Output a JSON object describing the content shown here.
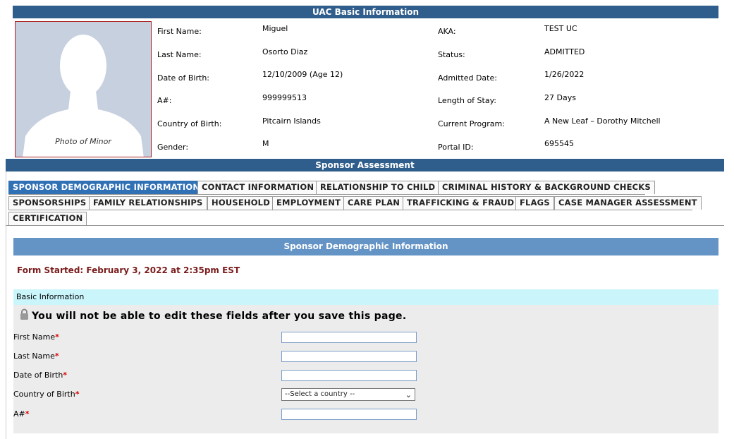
{
  "uac": {
    "header": "UAC Basic Information",
    "photo_caption": "Photo of Minor",
    "first_name_label": "First Name:",
    "first_name": "Miguel",
    "last_name_label": "Last Name:",
    "last_name": "Osorto Diaz",
    "dob_label": "Date of Birth:",
    "dob": "12/10/2009 (Age 12)",
    "anum_label": "A#:",
    "anum": "999999513",
    "country_label": "Country of Birth:",
    "country": "Pitcairn Islands",
    "gender_label": "Gender:",
    "gender": "M",
    "aka_label": "AKA:",
    "aka": "TEST UC",
    "status_label": "Status:",
    "status": "ADMITTED",
    "admitted_label": "Admitted Date:",
    "admitted": "1/26/2022",
    "los_label": "Length of Stay:",
    "los": "27 Days",
    "program_label": "Current Program:",
    "program": "A New Leaf – Dorothy Mitchell",
    "portal_label": "Portal ID:",
    "portal": "695545"
  },
  "sponsor": {
    "header": "Sponsor Assessment",
    "tabs": [
      "SPONSOR DEMOGRAPHIC INFORMATION",
      "CONTACT INFORMATION",
      "RELATIONSHIP TO CHILD",
      "CRIMINAL HISTORY & BACKGROUND CHECKS",
      "SPONSORSHIPS",
      "FAMILY RELATIONSHIPS",
      "HOUSEHOLD",
      "EMPLOYMENT",
      "CARE PLAN",
      "TRAFFICKING & FRAUD",
      "FLAGS",
      "CASE MANAGER ASSESSMENT",
      "CERTIFICATION"
    ],
    "active_tab": "SPONSOR DEMOGRAPHIC INFORMATION",
    "section_title": "Sponsor Demographic Information",
    "form_started": "Form Started: February 3, 2022 at 2:35pm EST",
    "basic_info": "Basic Information",
    "lock_note": "You will not be able to edit these fields after you save this page.",
    "fields": {
      "first_name": "First Name",
      "last_name": "Last Name",
      "dob": "Date of Birth",
      "country": "Country of Birth",
      "anum": "A#"
    },
    "required_mark": "*",
    "country_select_value": "--Select a country --"
  },
  "colors": {
    "header_bar": "#305e8c",
    "active_tab": "#3070b5",
    "section_band": "#6493c6",
    "form_started": "#7a1b1b",
    "basic_info_bg": "#c9f5fb",
    "required": "#dd0000"
  },
  "icons": {
    "photo_placeholder": "person-silhouette-icon",
    "lock": "lock-icon",
    "select_chevron": "chevron-down-icon"
  }
}
